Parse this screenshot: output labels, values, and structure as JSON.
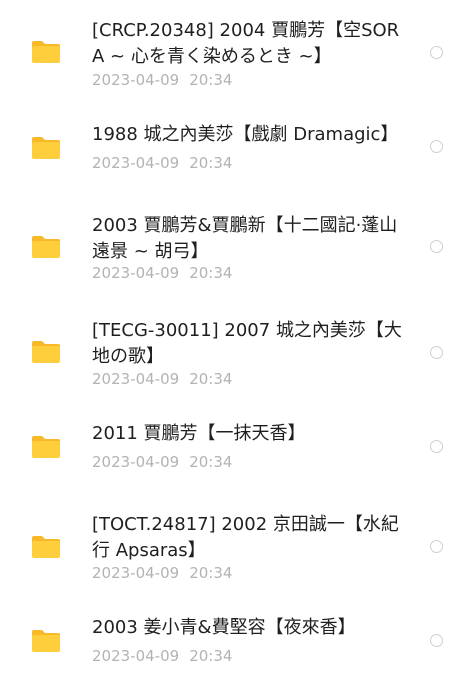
{
  "colors": {
    "folder": "#FFCE3D",
    "folder_tab": "#F7B928",
    "name_text": "#1f1f1f",
    "meta_text": "#b3b3b3",
    "radio_border": "#cfcfcf"
  },
  "files": [
    {
      "icon": "folder-icon",
      "name": "[CRCP.20348] 2004  賈鵬芳【空SORA ~ 心を青く染めるとき ~】",
      "date": "2023-04-09",
      "time": "20:34",
      "selected": false
    },
    {
      "icon": "folder-icon",
      "name": "1988  城之內美莎【戲劇  Dramagic】",
      "date": "2023-04-09",
      "time": "20:34",
      "selected": false
    },
    {
      "icon": "folder-icon",
      "name": "2003  賈鵬芳&賈鵬新【十二國記·蓬山遠景 ~ 胡弓】",
      "date": "2023-04-09",
      "time": "20:34",
      "selected": false
    },
    {
      "icon": "folder-icon",
      "name": "[TECG-30011] 2007  城之內美莎【大地の歌】",
      "date": "2023-04-09",
      "time": "20:34",
      "selected": false
    },
    {
      "icon": "folder-icon",
      "name": "2011  賈鵬芳【一抹天香】",
      "date": "2023-04-09",
      "time": "20:34",
      "selected": false
    },
    {
      "icon": "folder-icon",
      "name": "[TOCT.24817] 2002  京田誠一【水紀行  Apsaras】",
      "date": "2023-04-09",
      "time": "20:34",
      "selected": false
    },
    {
      "icon": "folder-icon",
      "name": "2003  姜小青&費堅容【夜來香】",
      "date": "2023-04-09",
      "time": "20:34",
      "selected": false
    }
  ]
}
